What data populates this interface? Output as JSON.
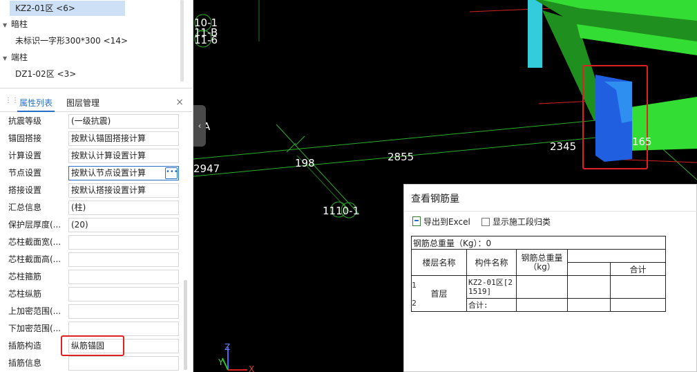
{
  "tree": {
    "selected_item": "KZ2-01区 <6>",
    "groups": [
      {
        "label": "暗柱",
        "item": "未标识一字形300*300 <14>"
      },
      {
        "label": "端柱",
        "item": "DZ1-02区 <3>"
      }
    ]
  },
  "tabs": {
    "properties": "属性列表",
    "layers": "图层管理",
    "close": "×"
  },
  "properties": [
    {
      "label": "抗震等级",
      "value": "(一级抗震)"
    },
    {
      "label": "锚固搭接",
      "value": "按默认锚固搭接计算"
    },
    {
      "label": "计算设置",
      "value": "按默认计算设置计算"
    },
    {
      "label": "节点设置",
      "value": "按默认节点设置计算"
    },
    {
      "label": "搭接设置",
      "value": "按默认搭接设置计算"
    },
    {
      "label": "汇总信息",
      "value": "(柱)"
    },
    {
      "label": "保护层厚度(...",
      "value": "(20)"
    },
    {
      "label": "芯柱截面宽(...",
      "value": ""
    },
    {
      "label": "芯柱截面高(...",
      "value": ""
    },
    {
      "label": "芯柱箍筋",
      "value": ""
    },
    {
      "label": "芯柱纵筋",
      "value": ""
    },
    {
      "label": "上加密范围(...",
      "value": ""
    },
    {
      "label": "下加密范围(...",
      "value": ""
    },
    {
      "label": "插筋构造",
      "value": "纵筋锚固"
    },
    {
      "label": "插筋信息",
      "value": ""
    }
  ],
  "viewport": {
    "collapse_glyph": "‹",
    "axis_labels": [
      "10-1",
      "11-B",
      "11-6",
      "A",
      "1110-1"
    ],
    "dimensions": [
      "2947",
      "198",
      "2855",
      "2345",
      "165"
    ],
    "axes": {
      "z": "Z",
      "y": "Y",
      "x": "X"
    },
    "colors": {
      "beam": "#33dd33",
      "beam_dark": "#1f8f1f",
      "column": "#1f5fe0",
      "column_light": "#2f8ff0",
      "cyan": "#33ccdd",
      "highlight": "#e02020"
    }
  },
  "rebar_dialog": {
    "title": "查看钢筋量",
    "export_label": "导出到Excel",
    "show_stage_label": "显示施工段归类",
    "total_weight": "钢筋总重量（Kg）：0",
    "col_floor": "楼层名称",
    "col_component": "构件名称",
    "col_weight": "钢筋总重量（kg）",
    "col_subtotal": "合计",
    "row1_index": "1",
    "row2_index": "2",
    "floor_name": "首层",
    "component_name": "KZ2-01区[21519]",
    "row_total": "合计:"
  }
}
